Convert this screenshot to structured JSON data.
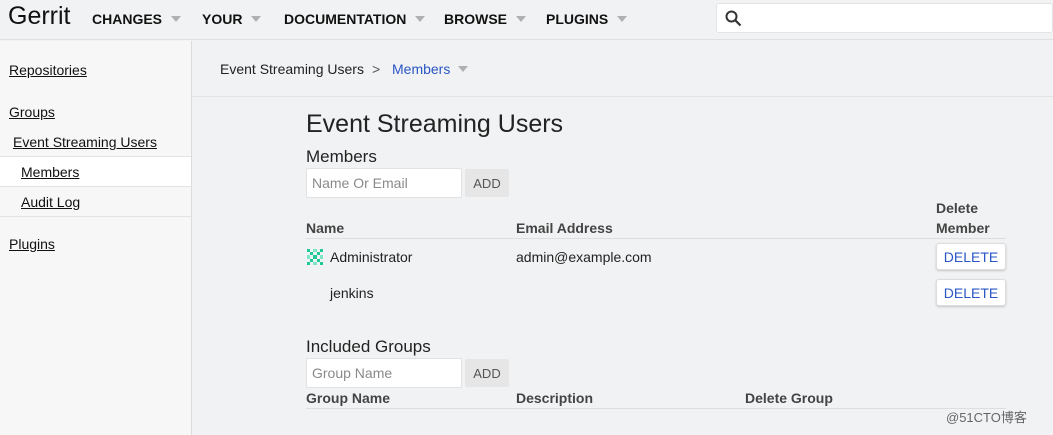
{
  "topbar": {
    "brand": "Gerrit",
    "nav": [
      {
        "label": "CHANGES"
      },
      {
        "label": "YOUR"
      },
      {
        "label": "DOCUMENTATION"
      },
      {
        "label": "BROWSE"
      },
      {
        "label": "PLUGINS"
      }
    ],
    "search_placeholder": ""
  },
  "sidebar": {
    "repositories": "Repositories",
    "groups": "Groups",
    "group_name": "Event Streaming Users",
    "members": "Members",
    "audit_log": "Audit Log",
    "plugins": "Plugins"
  },
  "breadcrumb": {
    "group": "Event Streaming Users",
    "separator": ">",
    "current": "Members"
  },
  "main": {
    "title": "Event Streaming Users",
    "members_heading": "Members",
    "member_input_placeholder": "Name Or Email",
    "add_label": "ADD",
    "columns": {
      "name": "Name",
      "email": "Email Address",
      "delete_line1": "Delete",
      "delete_line2": "Member"
    },
    "rows": [
      {
        "name": "Administrator",
        "email": "admin@example.com",
        "action": "DELETE"
      },
      {
        "name": "jenkins",
        "email": "",
        "action": "DELETE"
      }
    ],
    "included_heading": "Included Groups",
    "group_input_placeholder": "Group Name",
    "group_add_label": "ADD",
    "group_columns": {
      "name": "Group Name",
      "description": "Description",
      "delete": "Delete Group"
    }
  },
  "watermark": "@51CTO博客",
  "colors": {
    "link": "#2a56c6",
    "background": "#f1f2f3",
    "avatar": "#20c997"
  }
}
